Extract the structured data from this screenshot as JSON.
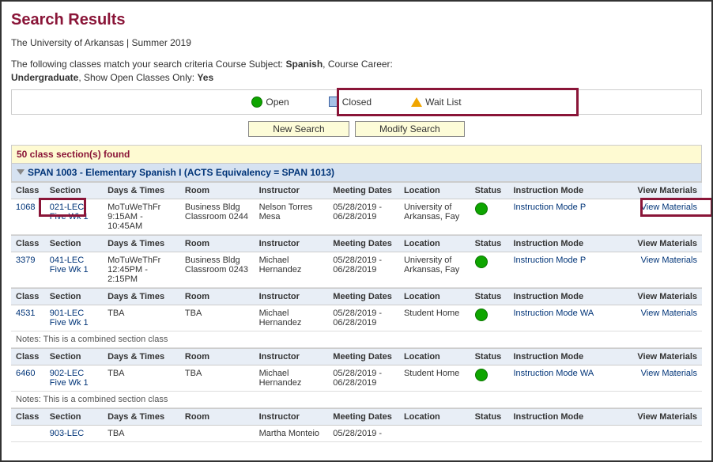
{
  "page": {
    "title": "Search Results",
    "sub": "The University of Arkansas | Summer 2019",
    "criteria_a": "The following classes match your search criteria Course Subject: ",
    "criteria_subj": "Spanish",
    "criteria_b": ",  Course Career: ",
    "criteria_career": "Undergraduate",
    "criteria_c": ",  Show Open Classes Only: ",
    "criteria_open": "Yes"
  },
  "legend": {
    "open": "Open",
    "closed": "Closed",
    "wait": "Wait List"
  },
  "buttons": {
    "new_search": "New Search",
    "modify_search": "Modify Search"
  },
  "found": "50 class section(s) found",
  "course": "SPAN 1003 - Elementary Spanish I (ACTS Equivalency = SPAN 1013)",
  "cols": {
    "class": "Class",
    "section": "Section",
    "dt": "Days & Times",
    "room": "Room",
    "instr": "Instructor",
    "md": "Meeting Dates",
    "loc": "Location",
    "status": "Status",
    "im": "Instruction Mode",
    "vm": "View Materials"
  },
  "rows": [
    {
      "class": "1068",
      "sect1": "021-LEC",
      "sect2": "Five Wk 1",
      "dt": "MoTuWeThFr 9:15AM - 10:45AM",
      "room": "Business Bldg Classroom 0244",
      "instr": "Nelson Torres Mesa",
      "md": "05/28/2019 - 06/28/2019",
      "loc": "University of Arkansas, Fay",
      "im": "Instruction Mode P",
      "vm": "View Materials",
      "notes": ""
    },
    {
      "class": "3379",
      "sect1": "041-LEC",
      "sect2": "Five Wk 1",
      "dt": "MoTuWeThFr 12:45PM - 2:15PM",
      "room": "Business Bldg Classroom 0243",
      "instr": "Michael Hernandez",
      "md": "05/28/2019 - 06/28/2019",
      "loc": "University of Arkansas, Fay",
      "im": "Instruction Mode P",
      "vm": "View Materials",
      "notes": ""
    },
    {
      "class": "4531",
      "sect1": "901-LEC",
      "sect2": "Five Wk 1",
      "dt": "TBA",
      "room": "TBA",
      "instr": "Michael Hernandez",
      "md": "05/28/2019 - 06/28/2019",
      "loc": "Student Home",
      "im": "Instruction Mode WA",
      "vm": "View Materials",
      "notes": "Notes: This is a combined section class"
    },
    {
      "class": "6460",
      "sect1": "902-LEC",
      "sect2": "Five Wk 1",
      "dt": "TBA",
      "room": "TBA",
      "instr": "Michael Hernandez",
      "md": "05/28/2019 - 06/28/2019",
      "loc": "Student Home",
      "im": "Instruction Mode WA",
      "vm": "View Materials",
      "notes": "Notes: This is a combined section class"
    },
    {
      "class": "",
      "sect1": "903-LEC",
      "sect2": "",
      "dt": "TBA",
      "room": "",
      "instr": "Martha Monteio",
      "md": "05/28/2019 -",
      "loc": "",
      "im": "",
      "vm": "",
      "notes": ""
    }
  ]
}
